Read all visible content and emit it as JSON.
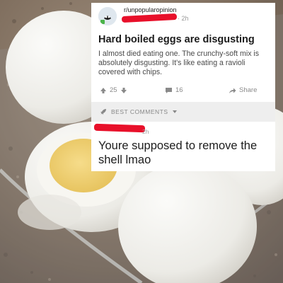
{
  "post": {
    "subreddit": "r/unpopularopinion",
    "time": "· 2h",
    "title": "Hard boiled eggs are disgusting",
    "body": "I almost died eating one. The crunchy-soft mix is absolutely disgusting. It's like eating a ravioli covered with chips.",
    "upvotes": "25",
    "comments": "16",
    "share_label": "Share"
  },
  "comments_bar": {
    "label": "BEST COMMENTS"
  },
  "comment": {
    "time": "2h",
    "text": "Youre supposed to remove the shell lmao"
  },
  "colors": {
    "redaction": "#e8102a",
    "card": "#ffffff",
    "bar": "#eeeeee"
  },
  "icons": [
    "reddit-avatar-icon",
    "upvote-icon",
    "downvote-icon",
    "comment-icon",
    "share-icon",
    "rocket-icon",
    "chevron-down-icon"
  ]
}
